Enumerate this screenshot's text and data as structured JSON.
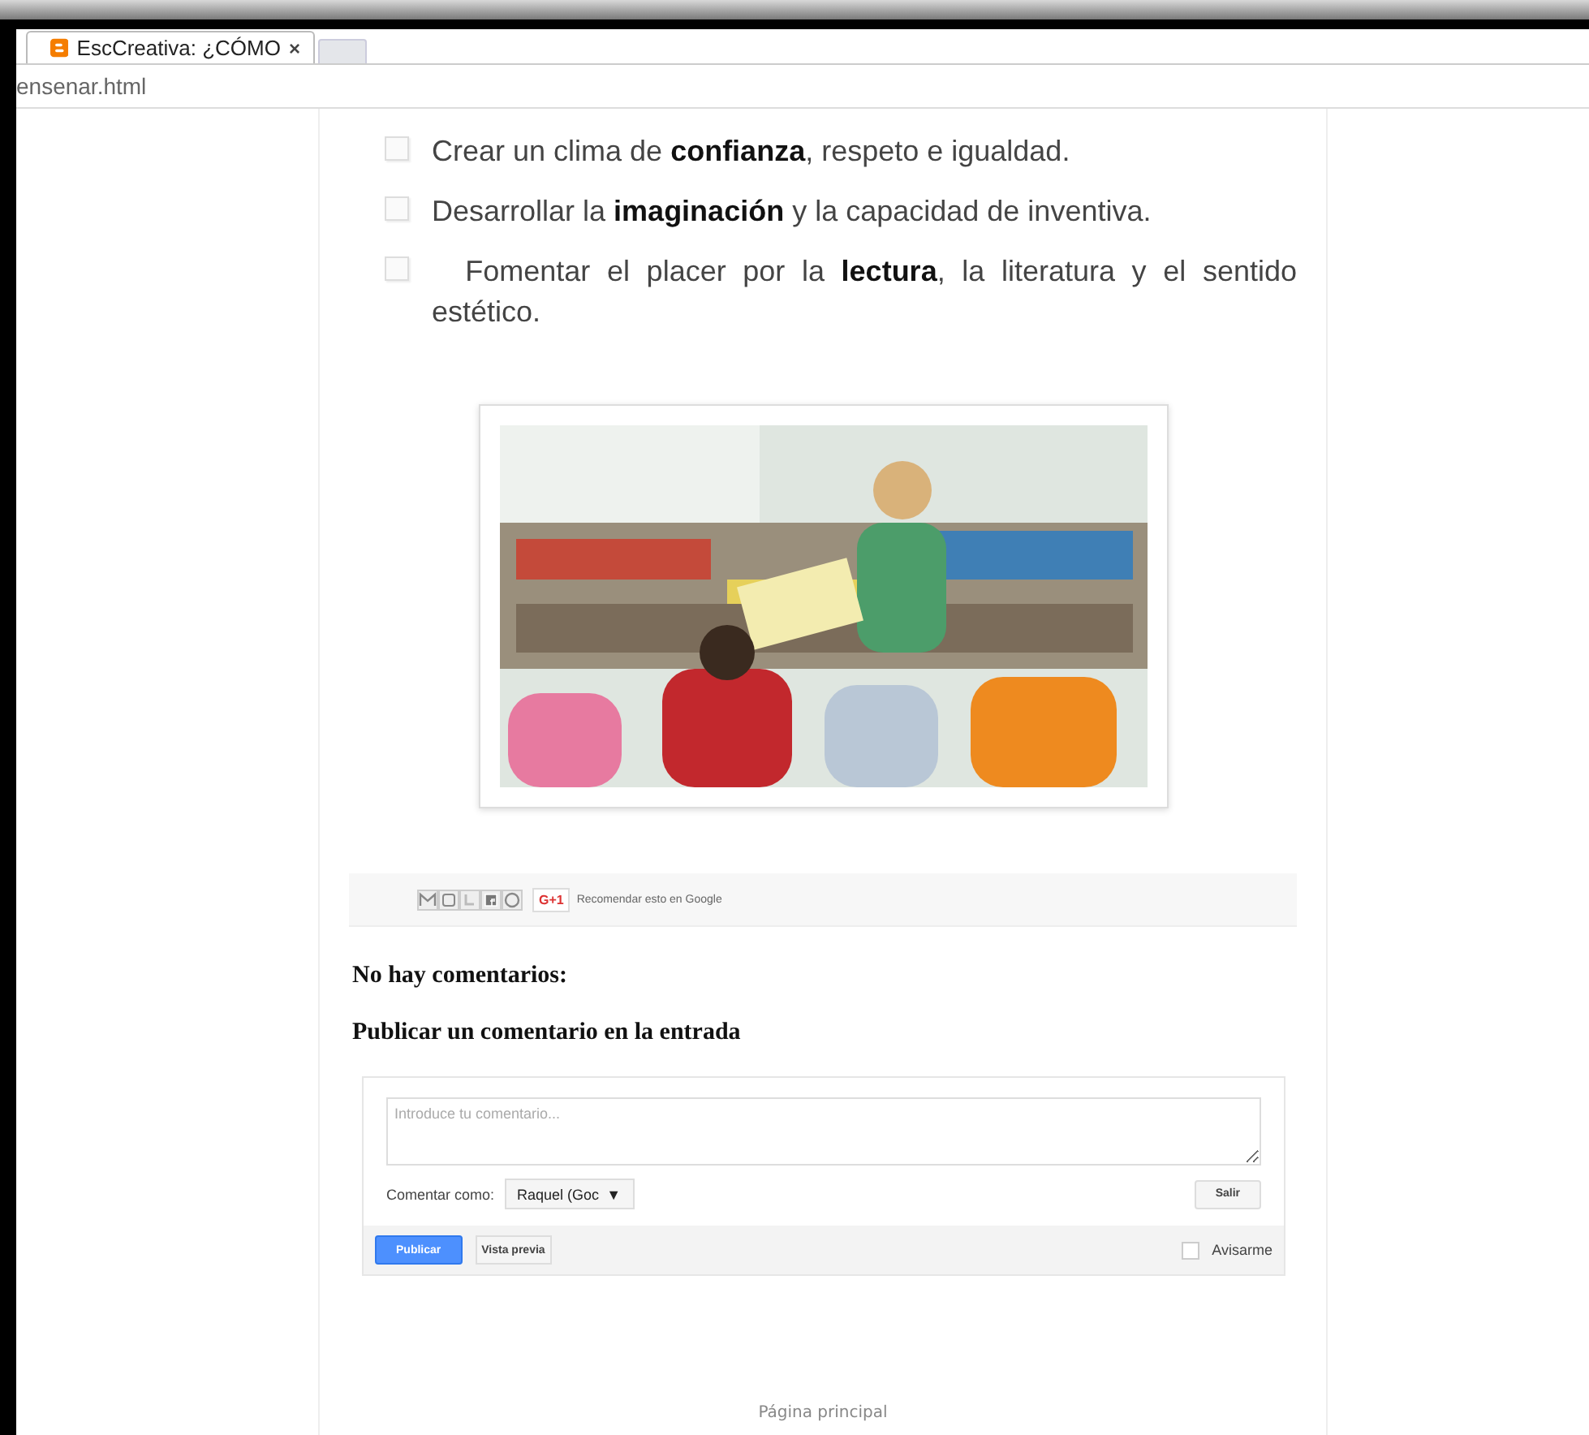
{
  "browser": {
    "tab_title": "EscCreativa: ¿CÓMO",
    "tab_close": "×",
    "address": "ensenar.html"
  },
  "post": {
    "list": [
      {
        "text": "Crear un clima de **confianza**, respeto e igualdad."
      },
      {
        "text": "Desarrollar la **imaginación** y la capacidad de inventiva."
      },
      {
        "text": "  Fomentar el placer por la **lectura**, la literatura y el sentido estético."
      }
    ]
  },
  "share_bar": {
    "plusone": "G+1",
    "recommend": "Recomendar esto en Google"
  },
  "comments": {
    "heading": "No hay comentarios:",
    "form_heading": "Publicar un comentario en la entrada",
    "placeholder": "Introduce tu comentario...",
    "comment_as_label": "Comentar como:",
    "identity": "Raquel (Goc",
    "identity_caret": "▼",
    "signout": "Salir",
    "publish": "Publicar",
    "preview": "Vista previa",
    "notify": {
      "label": "Avisarme",
      "checked": false
    }
  },
  "footer": {
    "home_link": "Página principal"
  }
}
